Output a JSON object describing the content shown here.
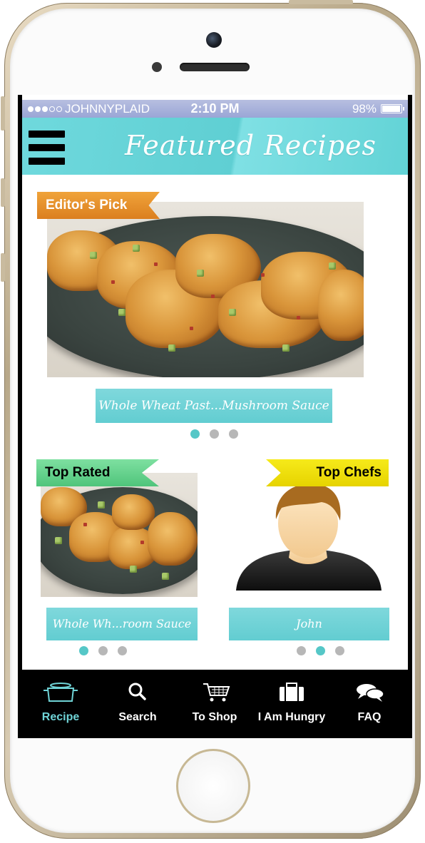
{
  "status_bar": {
    "carrier": "JOHNNYPLAID",
    "time": "2:10 PM",
    "battery": "98%"
  },
  "header": {
    "title": "Featured Recipes",
    "menu_icon": "hamburger-icon"
  },
  "featured": {
    "ribbon": "Editor's Pick",
    "caption": "Whole Wheat Past...Mushroom Sauce",
    "pager_active": 0,
    "pager_count": 3
  },
  "top_rated": {
    "ribbon": "Top Rated",
    "caption": "Whole Wh...room Sauce",
    "pager_active": 0,
    "pager_count": 3
  },
  "top_chefs": {
    "ribbon": "Top Chefs",
    "caption": "John",
    "pager_active": 1,
    "pager_count": 3
  },
  "tabs": [
    {
      "label": "Recipe",
      "icon": "pot-icon",
      "active": true
    },
    {
      "label": "Search",
      "icon": "search-icon",
      "active": false
    },
    {
      "label": "To Shop",
      "icon": "cart-icon",
      "active": false
    },
    {
      "label": "I Am Hungry",
      "icon": "briefcase-icon",
      "active": false
    },
    {
      "label": "FAQ",
      "icon": "chat-bubbles-icon",
      "active": false
    }
  ],
  "colors": {
    "accent": "#62cdd1",
    "active_tab": "#6fd3d6",
    "ribbon_orange": "#e08a25",
    "ribbon_green": "#5fcf86",
    "ribbon_yellow": "#efe00a"
  }
}
